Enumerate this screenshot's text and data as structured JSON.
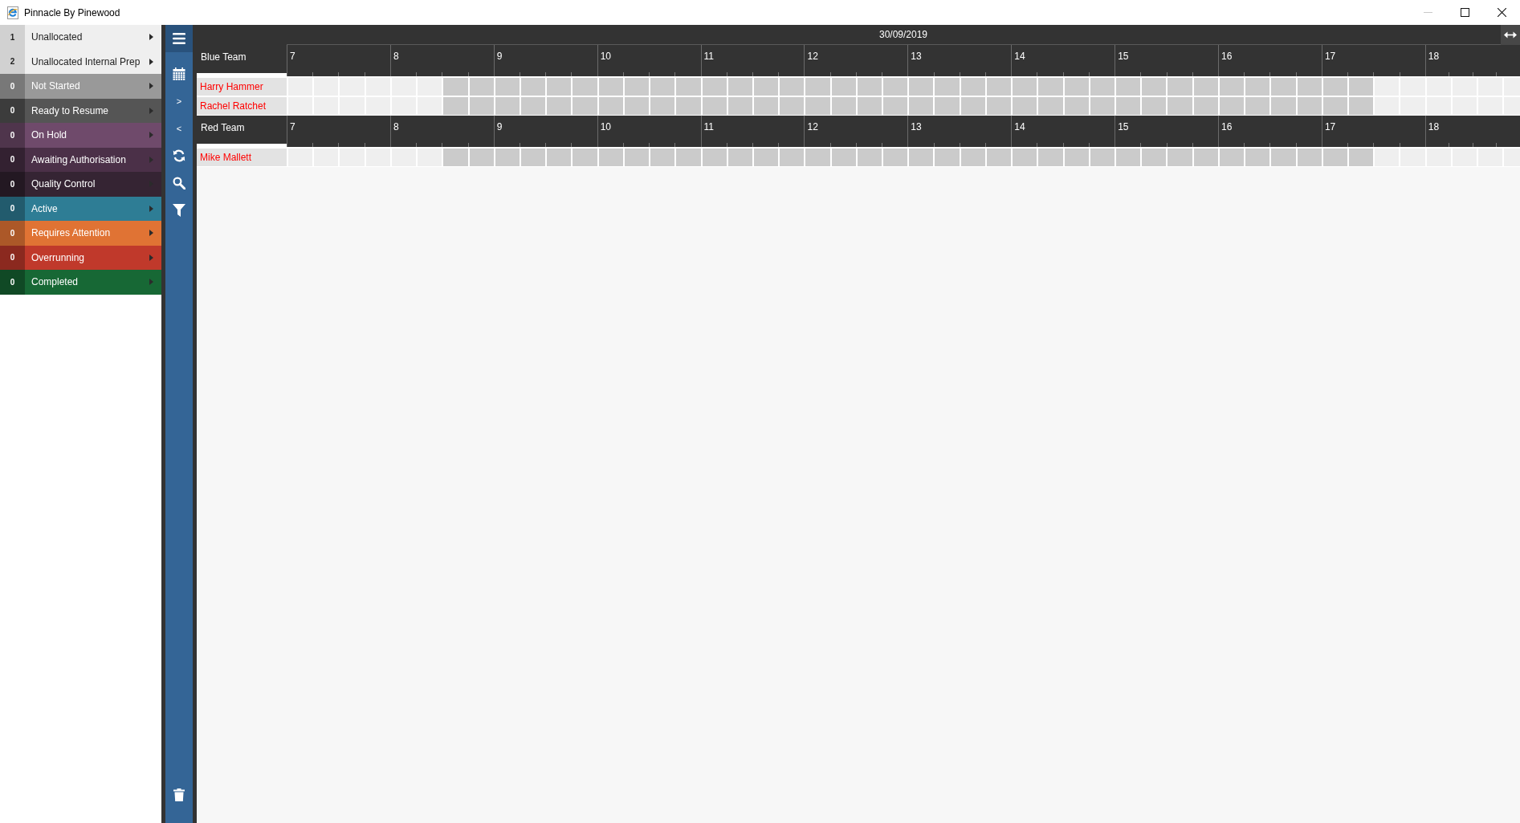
{
  "window": {
    "title": "Pinnacle By Pinewood",
    "controls": [
      {
        "kind": "minimize",
        "disabled": true
      },
      {
        "kind": "maximize",
        "disabled": false
      },
      {
        "kind": "close",
        "disabled": false
      }
    ]
  },
  "status_sidebar": {
    "items": [
      {
        "count": "1",
        "label": "Unallocated",
        "color": "#efefef"
      },
      {
        "count": "2",
        "label": "Unallocated Internal Prep",
        "color": "#efefef"
      },
      {
        "count": "0",
        "label": "Not Started",
        "color": "#999999"
      },
      {
        "count": "0",
        "label": "Ready to Resume",
        "color": "#555555"
      },
      {
        "count": "0",
        "label": "On Hold",
        "color": "#6f4a6b"
      },
      {
        "count": "0",
        "label": "Awaiting Authorisation",
        "color": "#4b3048"
      },
      {
        "count": "0",
        "label": "Quality Control",
        "color": "#352433"
      },
      {
        "count": "0",
        "label": "Active",
        "color": "#2e7d95"
      },
      {
        "count": "0",
        "label": "Requires Attention",
        "color": "#e07334"
      },
      {
        "count": "0",
        "label": "Overrunning",
        "color": "#c0392b"
      },
      {
        "count": "0",
        "label": "Completed",
        "color": "#176835"
      }
    ]
  },
  "toolbar": {
    "top": [
      {
        "kind": "menu"
      },
      {
        "kind": "calendar"
      },
      {
        "kind": "text",
        "label": ">"
      },
      {
        "kind": "text",
        "label": "<"
      },
      {
        "kind": "refresh"
      },
      {
        "kind": "search"
      },
      {
        "kind": "filter"
      }
    ],
    "bottom": [
      {
        "kind": "delete"
      }
    ]
  },
  "schedule": {
    "date": "30/09/2019",
    "teams": [
      {
        "name": "Blue Team",
        "hours": [
          "7",
          "8",
          "9",
          "10",
          "11",
          "12",
          "13",
          "14",
          "15",
          "16",
          "17",
          "18"
        ],
        "resources": [
          {
            "name": "Harry Hammer",
            "slots": [
              {
                "working": false
              },
              {
                "working": false
              },
              {
                "working": false
              },
              {
                "working": false
              },
              {
                "working": false
              },
              {
                "working": false
              },
              {
                "working": true
              },
              {
                "working": true
              },
              {
                "working": true
              },
              {
                "working": true
              },
              {
                "working": true
              },
              {
                "working": true
              },
              {
                "working": true
              },
              {
                "working": true
              },
              {
                "working": true
              },
              {
                "working": true
              },
              {
                "working": true
              },
              {
                "working": true
              },
              {
                "working": true
              },
              {
                "working": true
              },
              {
                "working": true
              },
              {
                "working": true
              },
              {
                "working": true
              },
              {
                "working": true
              },
              {
                "working": true
              },
              {
                "working": true
              },
              {
                "working": true
              },
              {
                "working": true
              },
              {
                "working": true
              },
              {
                "working": true
              },
              {
                "working": true
              },
              {
                "working": true
              },
              {
                "working": true
              },
              {
                "working": true
              },
              {
                "working": true
              },
              {
                "working": true
              },
              {
                "working": true
              },
              {
                "working": true
              },
              {
                "working": true
              },
              {
                "working": true
              },
              {
                "working": true
              },
              {
                "working": true
              },
              {
                "working": false
              },
              {
                "working": false
              },
              {
                "working": false
              },
              {
                "working": false
              },
              {
                "working": false
              },
              {
                "working": false
              }
            ]
          },
          {
            "name": "Rachel Ratchet",
            "slots": [
              {
                "working": false
              },
              {
                "working": false
              },
              {
                "working": false
              },
              {
                "working": false
              },
              {
                "working": false
              },
              {
                "working": false
              },
              {
                "working": true
              },
              {
                "working": true
              },
              {
                "working": true
              },
              {
                "working": true
              },
              {
                "working": true
              },
              {
                "working": true
              },
              {
                "working": true
              },
              {
                "working": true
              },
              {
                "working": true
              },
              {
                "working": true
              },
              {
                "working": true
              },
              {
                "working": true
              },
              {
                "working": true
              },
              {
                "working": true
              },
              {
                "working": true
              },
              {
                "working": true
              },
              {
                "working": true
              },
              {
                "working": true
              },
              {
                "working": true
              },
              {
                "working": true
              },
              {
                "working": true
              },
              {
                "working": true
              },
              {
                "working": true
              },
              {
                "working": true
              },
              {
                "working": true
              },
              {
                "working": true
              },
              {
                "working": true
              },
              {
                "working": true
              },
              {
                "working": true
              },
              {
                "working": true
              },
              {
                "working": true
              },
              {
                "working": true
              },
              {
                "working": true
              },
              {
                "working": true
              },
              {
                "working": true
              },
              {
                "working": true
              },
              {
                "working": false
              },
              {
                "working": false
              },
              {
                "working": false
              },
              {
                "working": false
              },
              {
                "working": false
              },
              {
                "working": false
              }
            ]
          }
        ]
      },
      {
        "name": "Red Team",
        "hours": [
          "7",
          "8",
          "9",
          "10",
          "11",
          "12",
          "13",
          "14",
          "15",
          "16",
          "17",
          "18"
        ],
        "resources": [
          {
            "name": "Mike Mallett",
            "slots": [
              {
                "working": false
              },
              {
                "working": false
              },
              {
                "working": false
              },
              {
                "working": false
              },
              {
                "working": false
              },
              {
                "working": false
              },
              {
                "working": true
              },
              {
                "working": true
              },
              {
                "working": true
              },
              {
                "working": true
              },
              {
                "working": true
              },
              {
                "working": true
              },
              {
                "working": true
              },
              {
                "working": true
              },
              {
                "working": true
              },
              {
                "working": true
              },
              {
                "working": true
              },
              {
                "working": true
              },
              {
                "working": true
              },
              {
                "working": true
              },
              {
                "working": true
              },
              {
                "working": true
              },
              {
                "working": true
              },
              {
                "working": true
              },
              {
                "working": true
              },
              {
                "working": true
              },
              {
                "working": true
              },
              {
                "working": true
              },
              {
                "working": true
              },
              {
                "working": true
              },
              {
                "working": true
              },
              {
                "working": true
              },
              {
                "working": true
              },
              {
                "working": true
              },
              {
                "working": true
              },
              {
                "working": true
              },
              {
                "working": true
              },
              {
                "working": true
              },
              {
                "working": true
              },
              {
                "working": true
              },
              {
                "working": true
              },
              {
                "working": true
              },
              {
                "working": false
              },
              {
                "working": false
              },
              {
                "working": false
              },
              {
                "working": false
              },
              {
                "working": false
              },
              {
                "working": false
              }
            ]
          }
        ]
      }
    ]
  }
}
